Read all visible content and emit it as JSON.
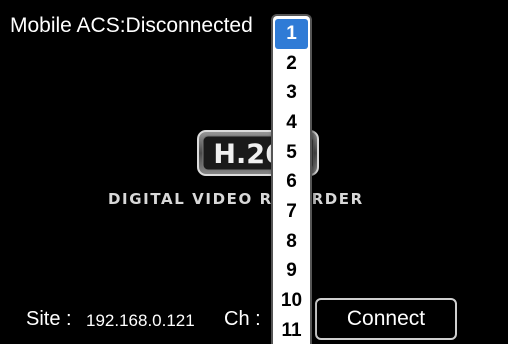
{
  "title": "Mobile ACS:Disconnected",
  "logo": {
    "badge_text": "H.264",
    "subtitle": "DIGITAL VIDEO RECORDER"
  },
  "site": {
    "label": "Site :",
    "value": "192.168.0.121"
  },
  "channel": {
    "label": "Ch :",
    "selected": "1",
    "options": [
      "1",
      "2",
      "3",
      "4",
      "5",
      "6",
      "7",
      "8",
      "9",
      "10",
      "11"
    ]
  },
  "connect_button": "Connect",
  "colors": {
    "background": "#000000",
    "text": "#ffffff",
    "selection": "#2f7bd6",
    "dropdown_bg": "#ffffff"
  }
}
